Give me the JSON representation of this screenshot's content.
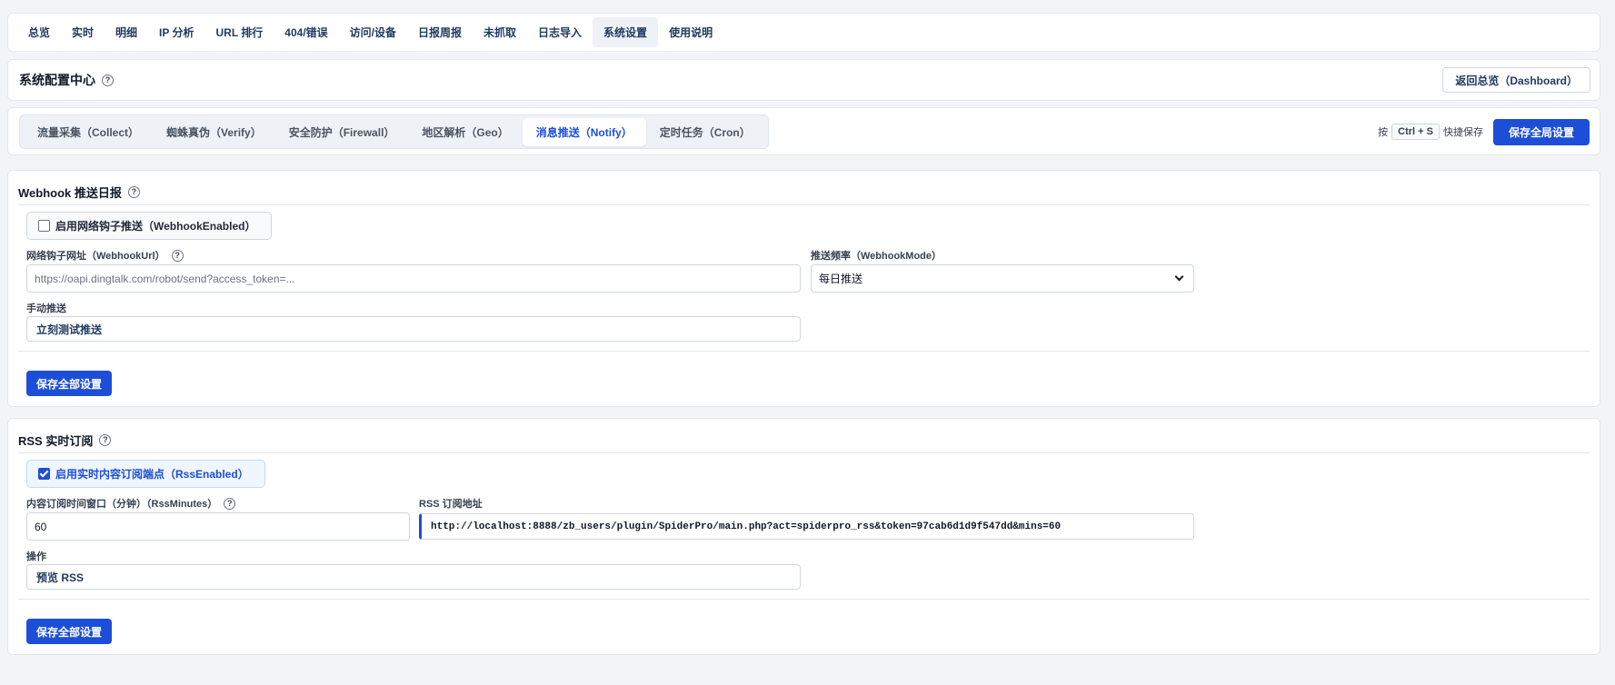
{
  "nav": [
    {
      "label": "总览",
      "active": false
    },
    {
      "label": "实时",
      "active": false
    },
    {
      "label": "明细",
      "active": false
    },
    {
      "label": "IP 分析",
      "active": false
    },
    {
      "label": "URL 排行",
      "active": false
    },
    {
      "label": "404/错误",
      "active": false
    },
    {
      "label": "访问/设备",
      "active": false
    },
    {
      "label": "日报周报",
      "active": false
    },
    {
      "label": "未抓取",
      "active": false
    },
    {
      "label": "日志导入",
      "active": false
    },
    {
      "label": "系统设置",
      "active": true
    },
    {
      "label": "使用说明",
      "active": false
    }
  ],
  "header": {
    "title": "系统配置中心",
    "help": "?",
    "back_label": "返回总览（Dashboard）"
  },
  "tabs": [
    {
      "label": "流量采集（Collect）",
      "active": false
    },
    {
      "label": "蜘蛛真伪（Verify）",
      "active": false
    },
    {
      "label": "安全防护（Firewall）",
      "active": false
    },
    {
      "label": "地区解析（Geo）",
      "active": false
    },
    {
      "label": "消息推送（Notify）",
      "active": true
    },
    {
      "label": "定时任务（Cron）",
      "active": false
    }
  ],
  "shortcut": {
    "prefix": "按",
    "key": "Ctrl + S",
    "suffix": "快捷保存"
  },
  "save_global_label": "保存全局设置",
  "webhook": {
    "title": "Webhook 推送日报",
    "enable_label": "启用网络钩子推送（WebhookEnabled）",
    "enabled": false,
    "url_label": "网络钩子网址（WebhookUrl）",
    "url_placeholder": "https://oapi.dingtalk.com/robot/send?access_token=...",
    "mode_label": "推送频率（WebhookMode）",
    "mode_value": "每日推送",
    "manual_label": "手动推送",
    "test_button": "立刻测试推送",
    "save_label": "保存全部设置"
  },
  "rss": {
    "title": "RSS 实时订阅",
    "enable_label": "启用实时内容订阅端点（RssEnabled）",
    "enabled": true,
    "minutes_label": "内容订阅时间窗口（分钟）（RssMinutes）",
    "minutes_value": "60",
    "url_label": "RSS 订阅地址",
    "url_value": "http://localhost:8888/zb_users/plugin/SpiderPro/main.php?act=spiderpro_rss&token=97cab6d1d9f547dd&mins=60",
    "action_label": "操作",
    "preview_button": "预览 RSS",
    "save_label": "保存全部设置"
  },
  "colors": {
    "accent": "#1d4ed8",
    "nav_text": "#1e3a5f",
    "background": "#f3f4f6"
  }
}
